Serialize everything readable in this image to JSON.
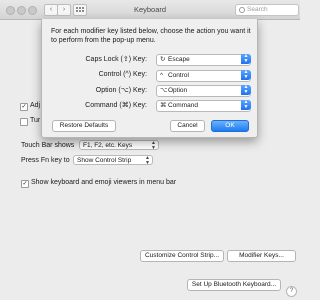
{
  "window": {
    "title": "Keyboard",
    "search_placeholder": "Search"
  },
  "sheet": {
    "description": "For each modifier key listed below, choose the action you want it to perform from the pop-up menu.",
    "rows": [
      {
        "label": "Caps Lock (⇪) Key:",
        "glyph": "↻",
        "value": "Escape"
      },
      {
        "label": "Control (^) Key:",
        "glyph": "^",
        "value": "Control"
      },
      {
        "label": "Option (⌥) Key:",
        "glyph": "⌥",
        "value": "Option"
      },
      {
        "label": "Command (⌘) Key:",
        "glyph": "⌘",
        "value": "Command"
      }
    ],
    "restore_label": "Restore Defaults",
    "cancel_label": "Cancel",
    "ok_label": "OK"
  },
  "main": {
    "adj_label": "Adj",
    "turn_label": "Tur",
    "touchbar_label": "Touch Bar shows",
    "touchbar_value": "F1, F2, etc. Keys",
    "fn_label": "Press Fn key to",
    "fn_value": "Show Control Strip",
    "viewers_label": "Show keyboard and emoji viewers in menu bar",
    "customize_label": "Customize Control Strip...",
    "modifier_label": "Modifier Keys...",
    "bluetooth_label": "Set Up Bluetooth Keyboard...",
    "help_label": "?"
  }
}
